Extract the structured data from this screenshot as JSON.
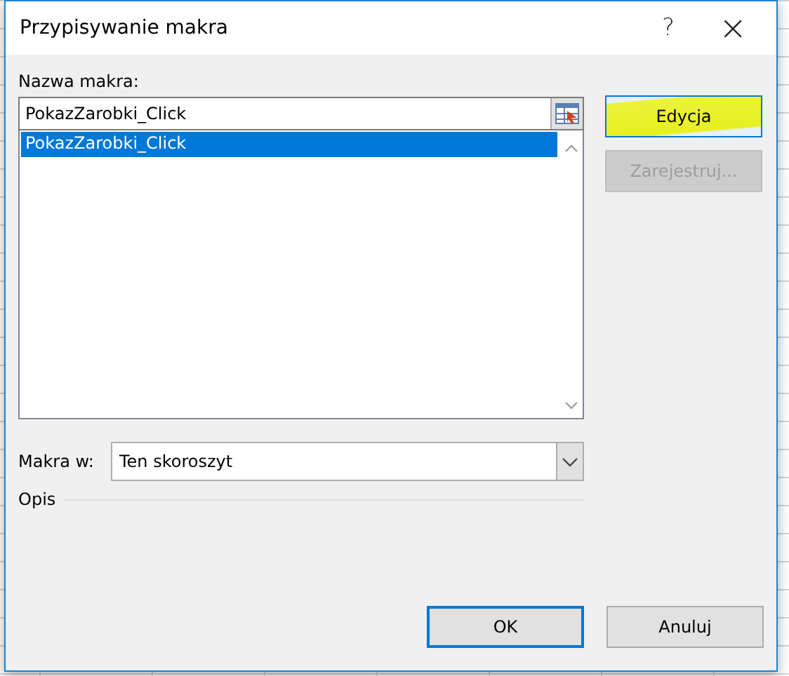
{
  "window": {
    "title": "Przypisywanie makra",
    "help_button": "?",
    "close_button": "×"
  },
  "macro_name": {
    "label": "Nazwa makra:",
    "value": "PokazZarobki_Click"
  },
  "macro_list": [
    {
      "name": "PokazZarobki_Click",
      "selected": true
    }
  ],
  "side_buttons": [
    {
      "label": "Edycja",
      "disabled": false,
      "highlighted": true
    },
    {
      "label": "Zarejestruj...",
      "disabled": true,
      "highlighted": false
    }
  ],
  "macros_in": {
    "label": "Makra w:",
    "value": "Ten skoroszyt"
  },
  "description": {
    "label": "Opis"
  },
  "buttons": [
    {
      "label": "OK",
      "default": true
    },
    {
      "label": "Anuluj",
      "default": false
    }
  ]
}
